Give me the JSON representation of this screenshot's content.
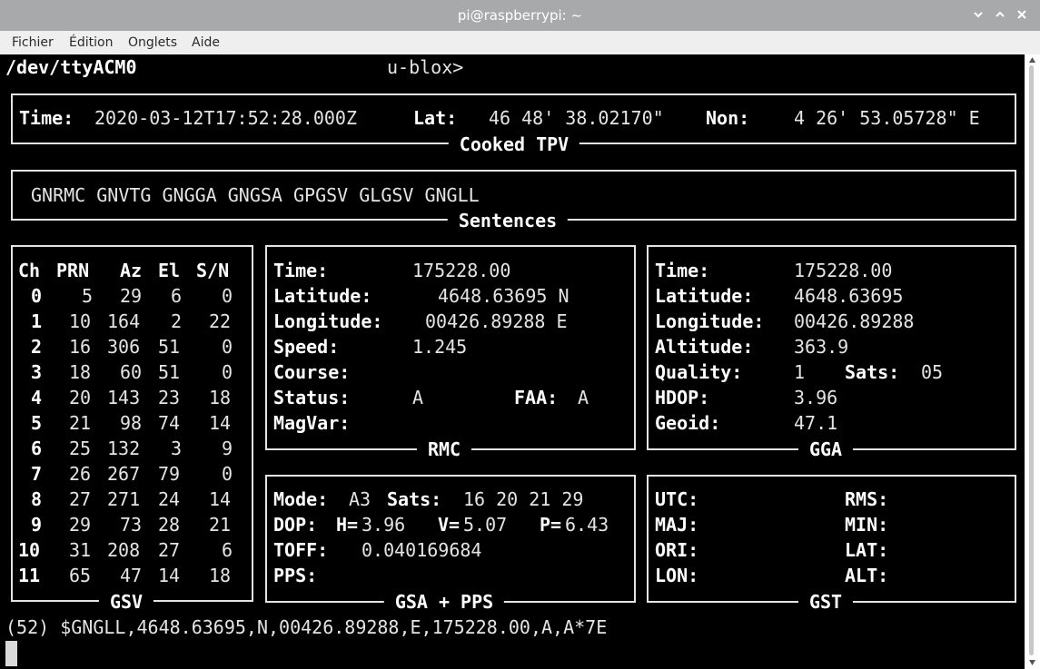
{
  "window": {
    "title": "pi@raspberrypi: ~",
    "buttons": [
      "chevron-down-icon",
      "chevron-up-icon",
      "close-icon"
    ]
  },
  "menu": {
    "items": [
      "Fichier",
      "Édition",
      "Onglets",
      "Aide"
    ]
  },
  "header": {
    "device": "/dev/ttyACM0",
    "receiver": "u-blox>"
  },
  "tpv": {
    "title": "Cooked TPV",
    "time_label": "Time:",
    "time_value": "2020-03-12T17:52:28.000Z",
    "lat_label": "Lat:",
    "lat_value": "46 48' 38.02170\"",
    "lon_label": "Non:",
    "lon_value": "4 26' 53.05728\" E"
  },
  "sentences": {
    "title": "Sentences",
    "list": "GNRMC GNVTG GNGGA GNGSA GPGSV GLGSV GNGLL"
  },
  "gsv": {
    "title": "GSV",
    "headers": [
      "Ch",
      "PRN",
      "Az",
      "El",
      "S/N"
    ],
    "rows": [
      [
        "0",
        "5",
        "29",
        "6",
        "0"
      ],
      [
        "1",
        "10",
        "164",
        "2",
        "22"
      ],
      [
        "2",
        "16",
        "306",
        "51",
        "0"
      ],
      [
        "3",
        "18",
        "60",
        "51",
        "0"
      ],
      [
        "4",
        "20",
        "143",
        "23",
        "18"
      ],
      [
        "5",
        "21",
        "98",
        "74",
        "14"
      ],
      [
        "6",
        "25",
        "132",
        "3",
        "9"
      ],
      [
        "7",
        "26",
        "267",
        "79",
        "0"
      ],
      [
        "8",
        "27",
        "271",
        "24",
        "14"
      ],
      [
        "9",
        "29",
        "73",
        "28",
        "21"
      ],
      [
        "10",
        "31",
        "208",
        "27",
        "6"
      ],
      [
        "11",
        "65",
        "47",
        "14",
        "18"
      ]
    ]
  },
  "rmc": {
    "title": "RMC",
    "time_label": "Time:",
    "time_value": "175228.00",
    "lat_label": "Latitude:",
    "lat_value": "4648.63695 N",
    "lon_label": "Longitude:",
    "lon_value": "00426.89288 E",
    "speed_label": "Speed:",
    "speed_value": "1.245",
    "course_label": "Course:",
    "status_label": "Status:",
    "status_value": "A",
    "faa_label": "FAA:",
    "faa_value": "A",
    "magvar_label": "MagVar:"
  },
  "gga": {
    "title": "GGA",
    "time_label": "Time:",
    "time_value": "175228.00",
    "lat_label": "Latitude:",
    "lat_value": "4648.63695",
    "lon_label": "Longitude:",
    "lon_value": "00426.89288",
    "alt_label": "Altitude:",
    "alt_value": "363.9",
    "quality_label": "Quality:",
    "quality_value": "1",
    "sats_label": "Sats:",
    "sats_value": "05",
    "hdop_label": "HDOP:",
    "hdop_value": "3.96",
    "geoid_label": "Geoid:",
    "geoid_value": "47.1"
  },
  "gsa": {
    "title": "GSA + PPS",
    "mode_label": "Mode:",
    "mode_value": "A3",
    "sats_label": "Sats:",
    "sats_value": "16 20 21 29",
    "dop_label": "DOP:",
    "h_label": "H=",
    "h_value": "3.96",
    "v_label": "V=",
    "v_value": "5.07",
    "p_label": "P=",
    "p_value": "6.43",
    "toff_label": "TOFF:",
    "toff_value": "0.040169684",
    "pps_label": "PPS:"
  },
  "gst": {
    "title": "GST",
    "utc_label": "UTC:",
    "rms_label": "RMS:",
    "maj_label": "MAJ:",
    "min_label": "MIN:",
    "ori_label": "ORI:",
    "lat_label": "LAT:",
    "lon_label": "LON:",
    "alt_label": "ALT:"
  },
  "raw": {
    "line": "(52) $GNGLL,4648.63695,N,00426.89288,E,175228.00,A,A*7E"
  }
}
